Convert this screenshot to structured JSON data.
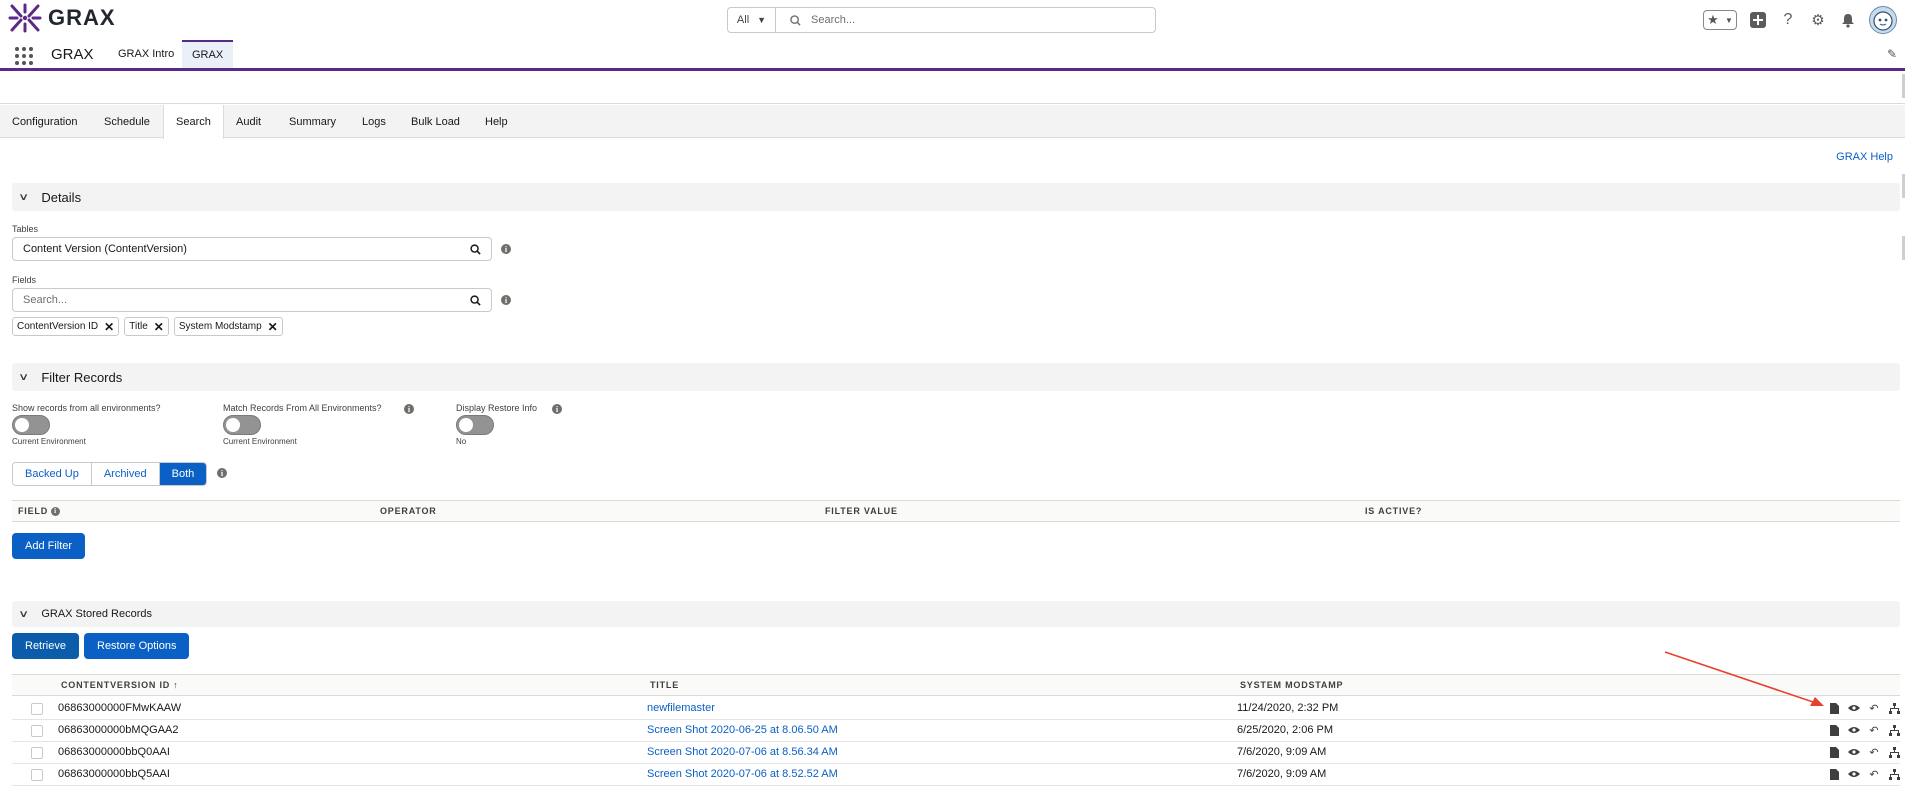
{
  "header": {
    "logo_text": "GRAX",
    "search_scope": "All",
    "search_placeholder": "Search..."
  },
  "nav": {
    "app_name": "GRAX",
    "tabs": [
      "GRAX Intro",
      "GRAX"
    ]
  },
  "app_tabs": [
    "Configuration",
    "Schedule",
    "Search",
    "Audit",
    "Summary",
    "Logs",
    "Bulk Load",
    "Help"
  ],
  "active_app_tab": "Search",
  "help_link": "GRAX Help",
  "details": {
    "title": "Details",
    "tables_label": "Tables",
    "tables_value": "Content Version (ContentVersion)",
    "fields_label": "Fields",
    "fields_placeholder": "Search...",
    "selected_fields": [
      "ContentVersion ID",
      "Title",
      "System Modstamp"
    ]
  },
  "filter": {
    "title": "Filter Records",
    "toggles": [
      {
        "label": "Show records from all environments?",
        "state": "Current Environment",
        "on": false
      },
      {
        "label": "Match Records From All Environments?",
        "state": "Current Environment",
        "on": false
      },
      {
        "label": "Display Restore Info",
        "state": "No",
        "on": false
      }
    ],
    "record_types": [
      "Backed Up",
      "Archived",
      "Both"
    ],
    "selected_record_type": "Both",
    "columns": [
      "FIELD",
      "OPERATOR",
      "FILTER VALUE",
      "IS ACTIVE?"
    ],
    "add_filter_label": "Add Filter"
  },
  "stored": {
    "title": "GRAX Stored Records",
    "retrieve_label": "Retrieve",
    "restore_label": "Restore Options",
    "columns": [
      "CONTENTVERSION ID",
      "TITLE",
      "SYSTEM MODSTAMP"
    ],
    "sort_indicator": "↑",
    "rows": [
      {
        "id": "06863000000FMwKAAW",
        "title": "newfilemaster",
        "modstamp": "11/24/2020, 2:32 PM"
      },
      {
        "id": "06863000000bMQGAA2",
        "title": "Screen Shot 2020-06-25 at 8.06.50 AM",
        "modstamp": "6/25/2020, 2:06 PM"
      },
      {
        "id": "06863000000bbQ0AAI",
        "title": "Screen Shot 2020-07-06 at 8.56.34 AM",
        "modstamp": "7/6/2020, 9:09 AM"
      },
      {
        "id": "06863000000bbQ5AAI",
        "title": "Screen Shot 2020-07-06 at 8.52.52 AM",
        "modstamp": "7/6/2020, 9:09 AM"
      }
    ]
  },
  "colors": {
    "brand": "#0a60c4",
    "nav_accent": "#5b2a86",
    "annotation_arrow": "#e8402f"
  }
}
